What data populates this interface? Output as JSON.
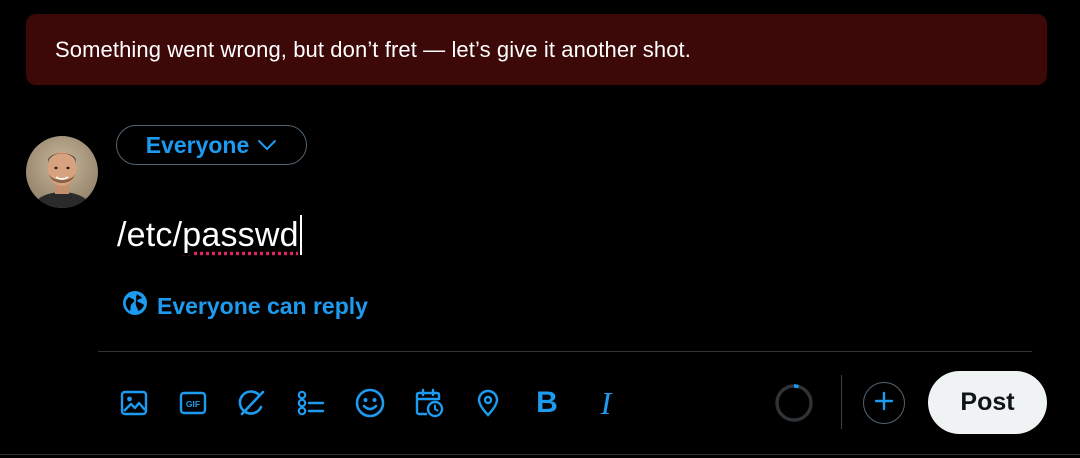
{
  "error_banner": {
    "message": "Something went wrong, but don’t fret — let’s give it another shot."
  },
  "composer": {
    "audience_label": "Everyone",
    "text": "/etc/passwd",
    "reply_setting_label": "Everyone can reply"
  },
  "toolbar": {
    "icons": [
      "image-icon",
      "gif-icon",
      "grok-icon",
      "poll-icon",
      "emoji-icon",
      "schedule-icon",
      "location-icon",
      "bold-icon",
      "italic-icon"
    ],
    "bold_label": "B",
    "italic_label": "I",
    "gif_label": "GIF"
  },
  "post_button": {
    "label": "Post"
  },
  "colors": {
    "accent": "#1d9bf0",
    "background": "#000000",
    "error_banner": "#3d0808",
    "post_button_bg": "#eff3f4",
    "border": "#536471"
  }
}
